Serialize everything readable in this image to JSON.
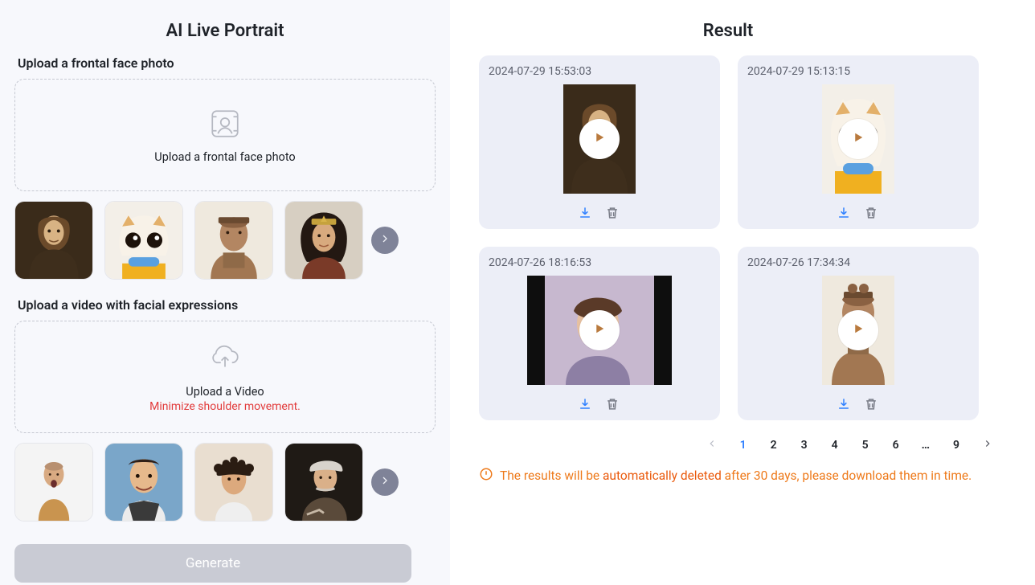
{
  "left": {
    "title": "AI Live Portrait",
    "upload_photo": {
      "label": "Upload a frontal face photo",
      "placeholder": "Upload a frontal face photo"
    },
    "photo_samples": [
      "mona-lisa",
      "cat",
      "terracotta",
      "wonder-woman"
    ],
    "upload_video": {
      "label": "Upload a video with facial expressions",
      "placeholder": "Upload a Video",
      "hint": "Minimize shoulder movement."
    },
    "video_samples": [
      "man-white-bg",
      "mr-bean",
      "curly-man",
      "einstein"
    ],
    "generate_label": "Generate"
  },
  "right": {
    "title": "Result",
    "results": [
      {
        "timestamp": "2024-07-29 15:53:03",
        "shape": "portrait",
        "thumb": "mona-lisa"
      },
      {
        "timestamp": "2024-07-29 15:13:15",
        "shape": "portrait",
        "thumb": "cat"
      },
      {
        "timestamp": "2024-07-26 18:16:53",
        "shape": "landscape",
        "thumb": "audrey"
      },
      {
        "timestamp": "2024-07-26 17:34:34",
        "shape": "portrait",
        "thumb": "terracotta"
      }
    ],
    "pagination": {
      "pages": [
        "1",
        "2",
        "3",
        "4",
        "5",
        "6",
        "…",
        "9"
      ],
      "active": "1"
    },
    "warning": {
      "pre": "The results will be ",
      "em": "automatically deleted",
      "post": " after 30 days, please download them in time."
    }
  }
}
